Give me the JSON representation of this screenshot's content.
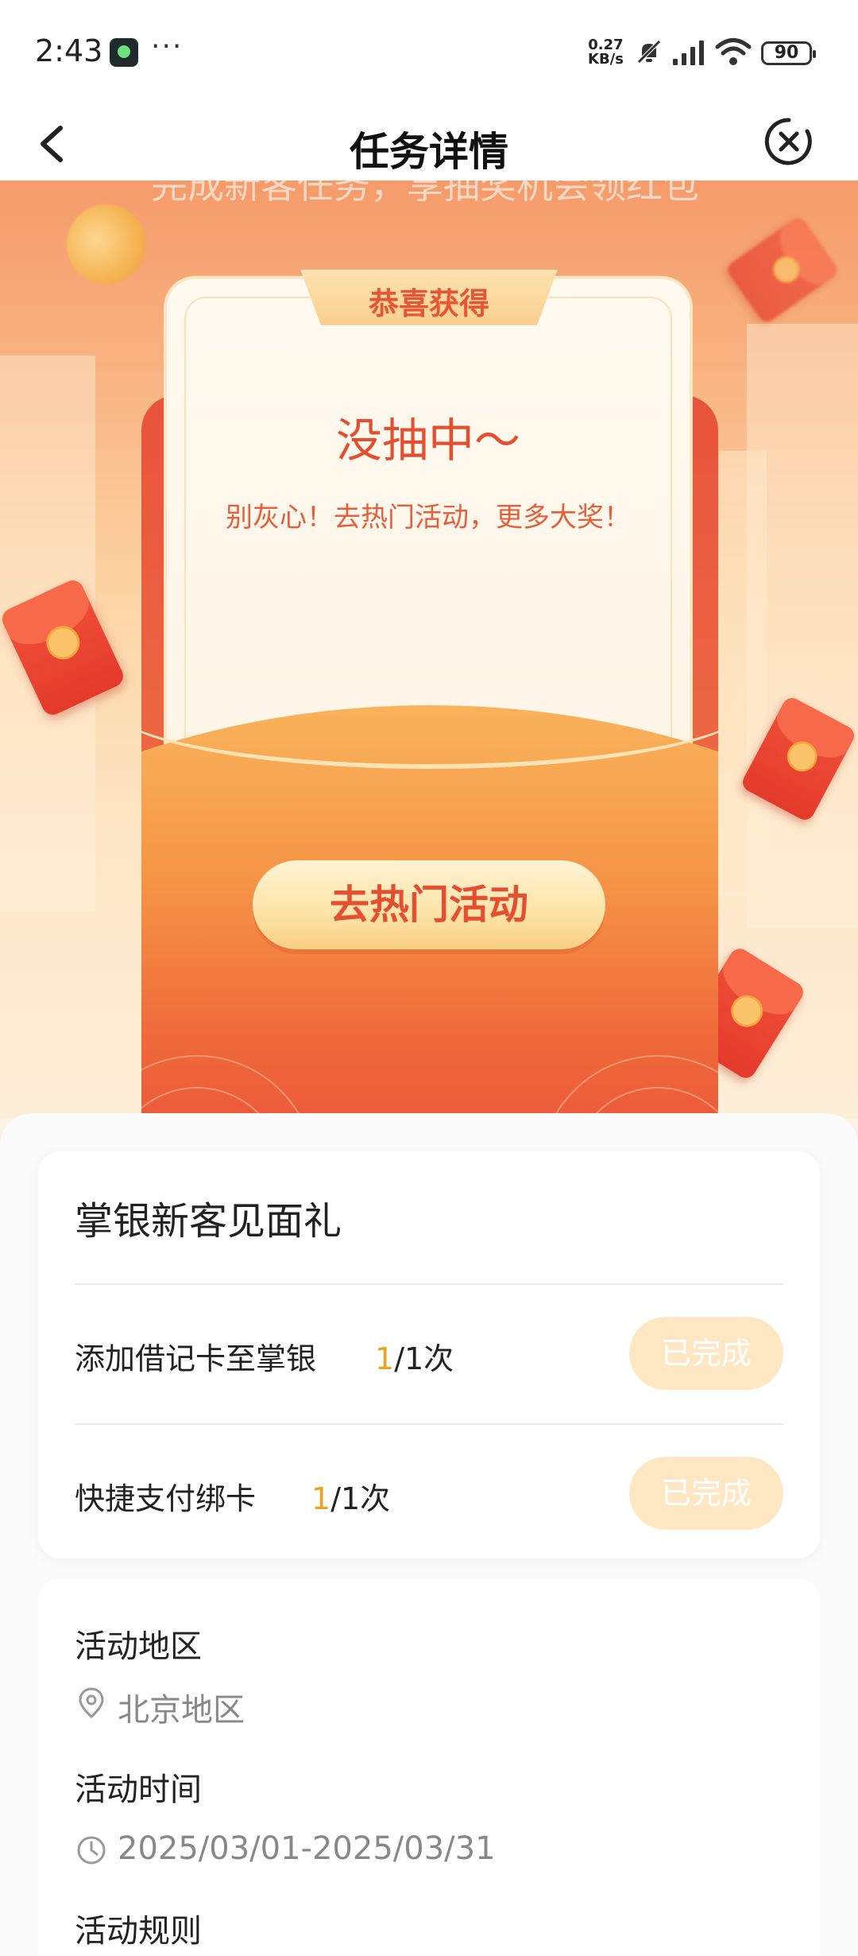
{
  "status_bar": {
    "time": "2:43",
    "dots": "···",
    "net_speed_value": "0.27",
    "net_speed_unit": "KB/s",
    "battery": "90"
  },
  "header": {
    "title": "任务详情"
  },
  "hero": {
    "faded_text": "完成新客任务，享抽奖机会领红包",
    "ribbon_label": "恭喜获得",
    "result_title": "没抽中～",
    "result_subtitle": "别灰心！去热门活动，更多大奖！",
    "cta_label": "去热门活动"
  },
  "task_card": {
    "title": "掌银新客见面礼",
    "tasks": [
      {
        "name": "添加借记卡至掌银",
        "done_count": "1",
        "total": "/1次",
        "status": "已完成"
      },
      {
        "name": "快捷支付绑卡",
        "done_count": "1",
        "total": "/1次",
        "status": "已完成"
      }
    ]
  },
  "info": {
    "region_label": "活动地区",
    "region_value": "北京地区",
    "time_label": "活动时间",
    "time_value": "2025/03/01-2025/03/31",
    "rules_label": "活动规则"
  },
  "colors": {
    "accent_red": "#e44f32",
    "highlight_orange": "#f0a31c",
    "done_button_bg": "#fde8c3"
  }
}
